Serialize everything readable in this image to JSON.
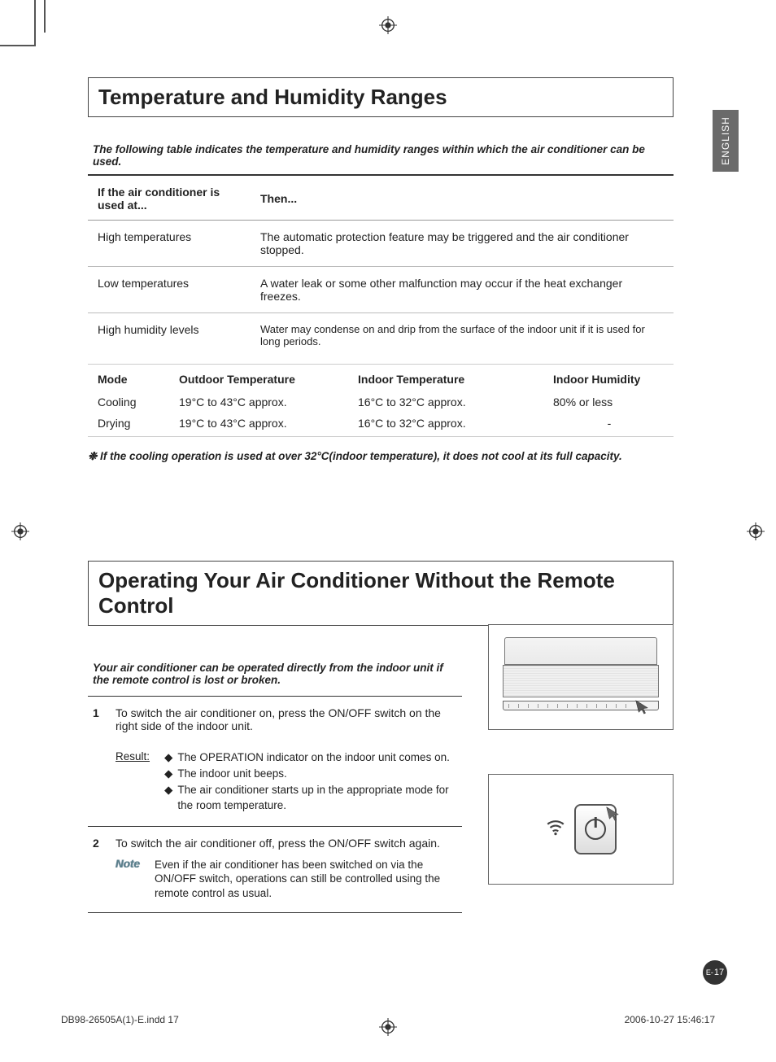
{
  "language_tab": "ENGLISH",
  "section1": {
    "title": "Temperature and Humidity Ranges",
    "intro": "The following table indicates the temperature and humidity ranges within which the air conditioner can be used.",
    "table1": {
      "headers": {
        "col1": "If the air conditioner is used at...",
        "col2": "Then..."
      },
      "rows": [
        {
          "c1": "High temperatures",
          "c2": "The automatic protection feature may be triggered and the air conditioner stopped."
        },
        {
          "c1": "Low temperatures",
          "c2": "A water leak or some other malfunction may occur if the heat exchanger freezes."
        },
        {
          "c1": "High humidity levels",
          "c2": "Water may condense on and drip from the surface of the indoor unit if it is used for long periods."
        }
      ]
    },
    "table2": {
      "headers": {
        "mode": "Mode",
        "outdoor": "Outdoor Temperature",
        "indoor": "Indoor Temperature",
        "humidity": "Indoor Humidity"
      },
      "rows": [
        {
          "mode": "Cooling",
          "outdoor": "19°C to 43°C approx.",
          "indoor": "16°C to 32°C approx.",
          "humidity": "80% or less"
        },
        {
          "mode": "Drying",
          "outdoor": "19°C to 43°C approx.",
          "indoor": "16°C to 32°C approx.",
          "humidity": "-"
        }
      ]
    },
    "footnote": "❉   If the cooling operation is used at over 32°C(indoor temperature), it does not cool at its full capacity."
  },
  "section2": {
    "title": "Operating Your Air Conditioner Without the Remote Control",
    "intro": "Your air conditioner can be operated directly from the indoor unit if the remote control is lost or broken.",
    "steps": [
      {
        "num": "1",
        "text": "To switch the air conditioner on, press the ON/OFF switch on the right side of the indoor unit.",
        "result_label": "Result:",
        "bullets": [
          "The OPERATION indicator on the indoor unit comes on.",
          "The indoor unit beeps.",
          "The air conditioner starts up in the appropriate mode for the room temperature."
        ]
      },
      {
        "num": "2",
        "text": "To switch the air conditioner off, press the ON/OFF switch again.",
        "note_label": "Note",
        "note_text": "Even if the air conditioner has been switched on via the ON/OFF switch, operations can still be controlled using the remote control as usual."
      }
    ]
  },
  "page_number": {
    "prefix": "E-",
    "num": "17"
  },
  "footer": {
    "left": "DB98-26505A(1)-E.indd   17",
    "right": "2006-10-27   15:46:17"
  }
}
